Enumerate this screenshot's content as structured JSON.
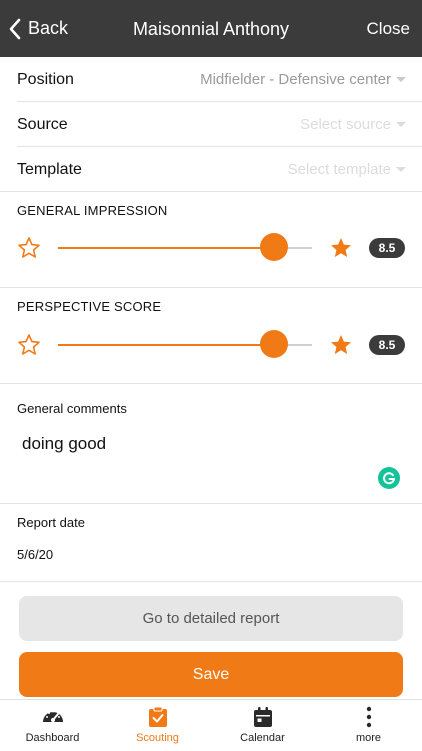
{
  "header": {
    "back_label": "Back",
    "title": "Maisonnial Anthony",
    "close_label": "Close"
  },
  "fields": {
    "position": {
      "label": "Position",
      "value": "Midfielder - Defensive center"
    },
    "source": {
      "label": "Source",
      "placeholder": "Select source"
    },
    "template": {
      "label": "Template",
      "placeholder": "Select template"
    }
  },
  "general_impression": {
    "label": "GENERAL IMPRESSION",
    "value": "8.5",
    "fraction": 0.85
  },
  "perspective_score": {
    "label": "PERSPECTIVE SCORE",
    "value": "8.5",
    "fraction": 0.85
  },
  "comments": {
    "label": "General comments",
    "text": "doing good"
  },
  "report_date": {
    "label": "Report date",
    "value": "5/6/20"
  },
  "buttons": {
    "detailed_report": "Go to detailed report",
    "save": "Save"
  },
  "tabs": [
    {
      "label": "Dashboard",
      "icon": "speedometer-icon",
      "active": false
    },
    {
      "label": "Scouting",
      "icon": "clipboard-check-icon",
      "active": true
    },
    {
      "label": "Calendar",
      "icon": "calendar-icon",
      "active": false
    },
    {
      "label": "more",
      "icon": "more-vertical-icon",
      "active": false
    }
  ],
  "colors": {
    "accent": "#f07a15",
    "header_bg": "#3b3b3b",
    "grammarly": "#15c39a"
  }
}
